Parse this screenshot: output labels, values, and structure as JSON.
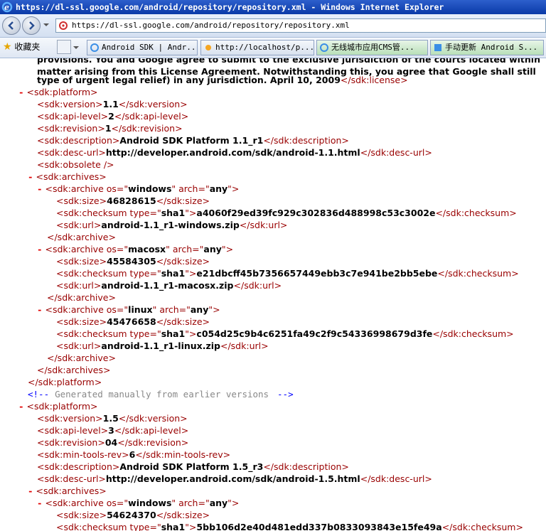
{
  "window": {
    "title": "https://dl-ssl.google.com/android/repository/repository.xml - Windows Internet Explorer"
  },
  "address": {
    "url": "https://dl-ssl.google.com/android/repository/repository.xml"
  },
  "favorites": {
    "label": "收藏夹"
  },
  "tabs": [
    {
      "label": "Android SDK | Andr..."
    },
    {
      "label": "http://localhost/p..."
    },
    {
      "label": "无线城市应用CMS管..."
    },
    {
      "label": "手动更新 Android S..."
    }
  ],
  "license": {
    "line1": "provisions. You and Google agree to submit to the exclusive jurisdiction of the courts located within",
    "line2": "matter arising from this License Agreement. Notwithstanding this, you agree that Google shall still",
    "line3": "type of urgent legal relief) in any jurisdiction. April 10, 2009",
    "close": "</sdk:license>"
  },
  "p1": {
    "version": "1.1",
    "api_level": "2",
    "revision": "1",
    "description": "Android SDK Platform 1.1_r1",
    "desc_url": "http://developer.android.com/sdk/android-1.1.html",
    "archives": [
      {
        "os": "windows",
        "arch": "any",
        "size": "46828615",
        "checksum": "a4060f29ed39fc929c302836d488998c53c3002e",
        "url": "android-1.1_r1-windows.zip"
      },
      {
        "os": "macosx",
        "arch": "any",
        "size": "45584305",
        "checksum": "e21dbcff45b7356657449ebb3c7e941be2bb5ebe",
        "url": "android-1.1_r1-macosx.zip"
      },
      {
        "os": "linux",
        "arch": "any",
        "size": "45476658",
        "checksum": "c054d25c9b4c6251fa49c2f9c54336998679d3fe",
        "url": "android-1.1_r1-linux.zip"
      }
    ]
  },
  "comment": {
    "open": "<!--",
    "text": "Generated manually from earlier versions",
    "close": "-->"
  },
  "p2": {
    "version": "1.5",
    "api_level": "3",
    "revision": "04",
    "min_tools_rev": "6",
    "description": "Android SDK Platform 1.5_r3",
    "desc_url": "http://developer.android.com/sdk/android-1.5.html",
    "archive_os": "windows",
    "archive_arch": "any",
    "size": "54624370",
    "checksum": "5bb106d2e40d481edd337b0833093843e15fe49a"
  },
  "tags": {
    "platform_open": "<sdk:platform>",
    "platform_close": "</sdk:platform>",
    "version_open": "<sdk:version>",
    "version_close": "</sdk:version>",
    "api_open": "<sdk:api-level>",
    "api_close": "</sdk:api-level>",
    "rev_open": "<sdk:revision>",
    "rev_close": "</sdk:revision>",
    "mintools_open": "<sdk:min-tools-rev>",
    "mintools_close": "</sdk:min-tools-rev>",
    "desc_open": "<sdk:description>",
    "desc_close": "</sdk:description>",
    "descurl_open": "<sdk:desc-url>",
    "descurl_close": "</sdk:desc-url>",
    "obsolete": "<sdk:obsolete />",
    "archives_open": "<sdk:archives>",
    "archives_close": "</sdk:archives>",
    "archive_open": "<sdk:archive",
    "archive_close": "</sdk:archive>",
    "os_attr": "os=\"",
    "arch_attr": "\" arch=\"",
    "attr_end": "\">",
    "size_open": "<sdk:size>",
    "size_close": "</sdk:size>",
    "checksum_open": "<sdk:checksum type=\"",
    "checksum_type": "sha1",
    "checksum_close": "</sdk:checksum>",
    "url_open": "<sdk:url>",
    "url_close": "</sdk:url>",
    "minus": "-"
  },
  "colors": {
    "titlebar": "#0a3aa8",
    "tag": "#990000",
    "bracket": "#0000ff",
    "minus": "#e30000"
  }
}
